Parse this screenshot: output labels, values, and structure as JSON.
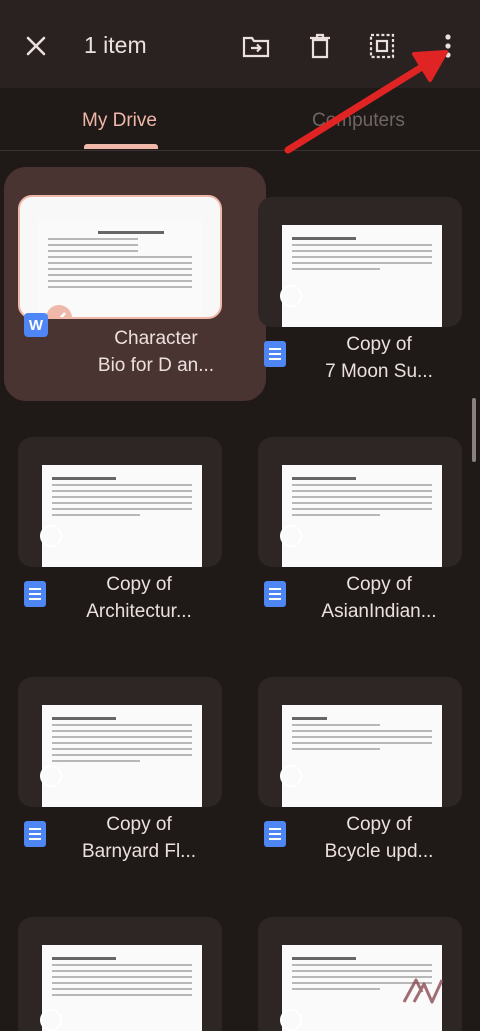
{
  "topbar": {
    "close_icon": "close-icon",
    "selection_count": "1 item",
    "actions": [
      "move-to-folder-icon",
      "trash-icon",
      "select-all-icon",
      "more-vert-icon"
    ]
  },
  "tabs": [
    {
      "label": "My Drive",
      "active": true
    },
    {
      "label": "Computers",
      "active": false
    }
  ],
  "files": [
    {
      "line1": "Character",
      "line2": "Bio for D an...",
      "type": "word",
      "selected": true
    },
    {
      "line1": "Copy of",
      "line2": "7 Moon Su...",
      "type": "docs",
      "selected": false
    },
    {
      "line1": "Copy of",
      "line2": "Architectur...",
      "type": "docs",
      "selected": false
    },
    {
      "line1": "Copy of",
      "line2": "AsianIndian...",
      "type": "docs",
      "selected": false
    },
    {
      "line1": "Copy of",
      "line2": "Barnyard Fl...",
      "type": "docs",
      "selected": false
    },
    {
      "line1": "Copy of",
      "line2": "Bcycle upd...",
      "type": "docs",
      "selected": false
    }
  ],
  "word_icon_letter": "W",
  "colors": {
    "accent": "#f0b8a8",
    "background": "#1f1918",
    "topbar": "#2a2221",
    "annotation_arrow": "#e02424",
    "docs_blue": "#4e86f6"
  }
}
